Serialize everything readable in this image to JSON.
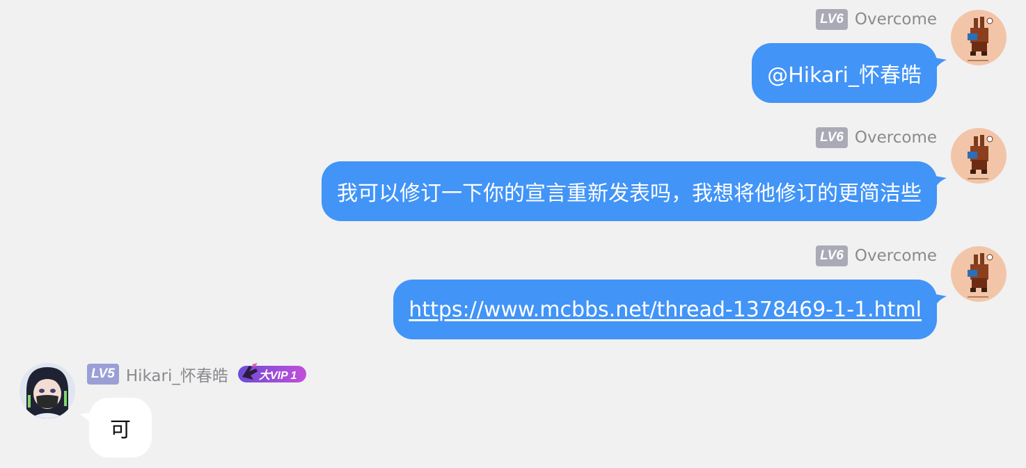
{
  "messages": [
    {
      "direction": "outgoing",
      "level": "LV6",
      "username": "Overcome",
      "text": "@Hikari_怀春皓"
    },
    {
      "direction": "outgoing",
      "level": "LV6",
      "username": "Overcome",
      "text": "我可以修订一下你的宣言重新发表吗，我想将他修订的更简洁些"
    },
    {
      "direction": "outgoing",
      "level": "LV6",
      "username": "Overcome",
      "text": "https://www.mcbbs.net/thread-1378469-1-1.html"
    },
    {
      "direction": "incoming",
      "level": "LV5",
      "username": "Hikari_怀春皓",
      "vip": "大VIP 1",
      "text": "可"
    }
  ],
  "colors": {
    "background": "#f1f1f1",
    "outgoing_bubble": "#4294f7",
    "incoming_bubble": "#ffffff",
    "level_badge_gray": "#a9aab5",
    "level_badge_purple": "#9b9fd6",
    "username": "#8a8a8f"
  },
  "icons": {
    "overcome_avatar": "pixel-rabbit-avatar-icon",
    "hikari_avatar": "anime-girl-avatar-icon",
    "vip": "vip-rabbit-icon"
  }
}
